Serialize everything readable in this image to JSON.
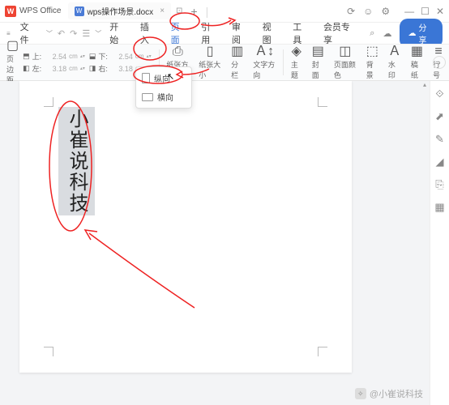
{
  "titlebar": {
    "app": "WPS Office",
    "doc": "wps操作场景.docx",
    "close": "×",
    "add": "+",
    "pipe": "|"
  },
  "menu": {
    "file": "文件",
    "items": [
      "开始",
      "插入",
      "页面",
      "引用",
      "审阅",
      "视图",
      "工具",
      "会员专享"
    ],
    "share": "分享"
  },
  "ribbon": {
    "margins_label": "页边距",
    "top": "2.54",
    "bottom": "2.54",
    "left": "3.18",
    "right": "3.18",
    "unit": "cm",
    "orient": "纸张方向",
    "size": "纸张大小",
    "columns": "分栏",
    "textdir": "文字方向",
    "theme": "主题",
    "cover": "封面",
    "pagecolor": "页面颜色",
    "bg": "背景",
    "watermark": "水印",
    "lined": "稿纸",
    "lineno": "行号"
  },
  "dropdown": {
    "portrait": "纵向",
    "landscape": "横向"
  },
  "doc_text": "小崔说科技",
  "watermark_text": "@小崔说科技"
}
